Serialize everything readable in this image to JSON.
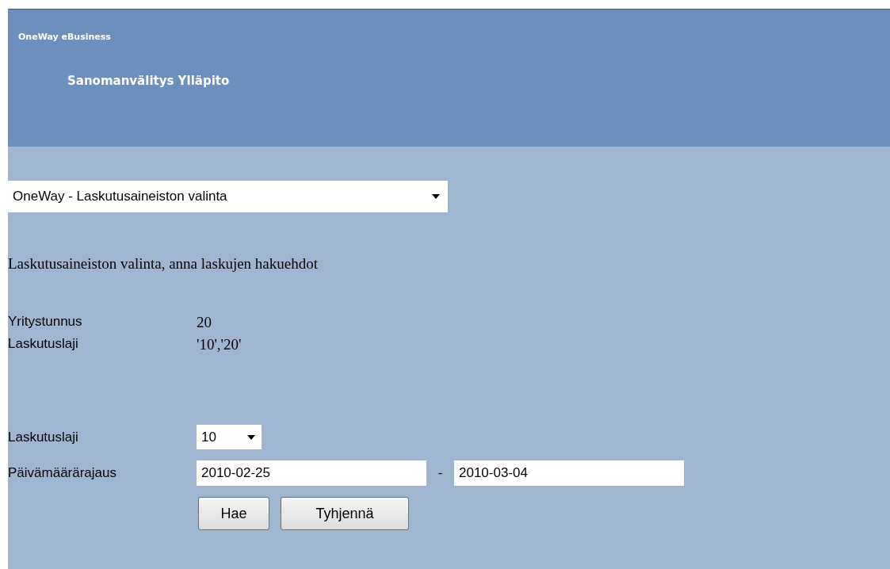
{
  "header": {
    "brand": "OneWay eBusiness",
    "title": "Sanomanvälitys Ylläpito"
  },
  "view_select": {
    "value": "OneWay - Laskutusaineiston valinta"
  },
  "heading": "Laskutusaineiston valinta, anna laskujen hakuehdot",
  "info": [
    {
      "label": "Yritystunnus",
      "value": "20"
    },
    {
      "label": "Laskutuslaji",
      "value": "'10','20'"
    }
  ],
  "form": {
    "type_label": "Laskutuslaji",
    "type_value": "10",
    "date_label": "Päivämäärärajaus",
    "date_from": "2010-02-25",
    "separator": "-",
    "date_to": "2010-03-04"
  },
  "buttons": [
    "Hae",
    "Tyhjennä"
  ]
}
